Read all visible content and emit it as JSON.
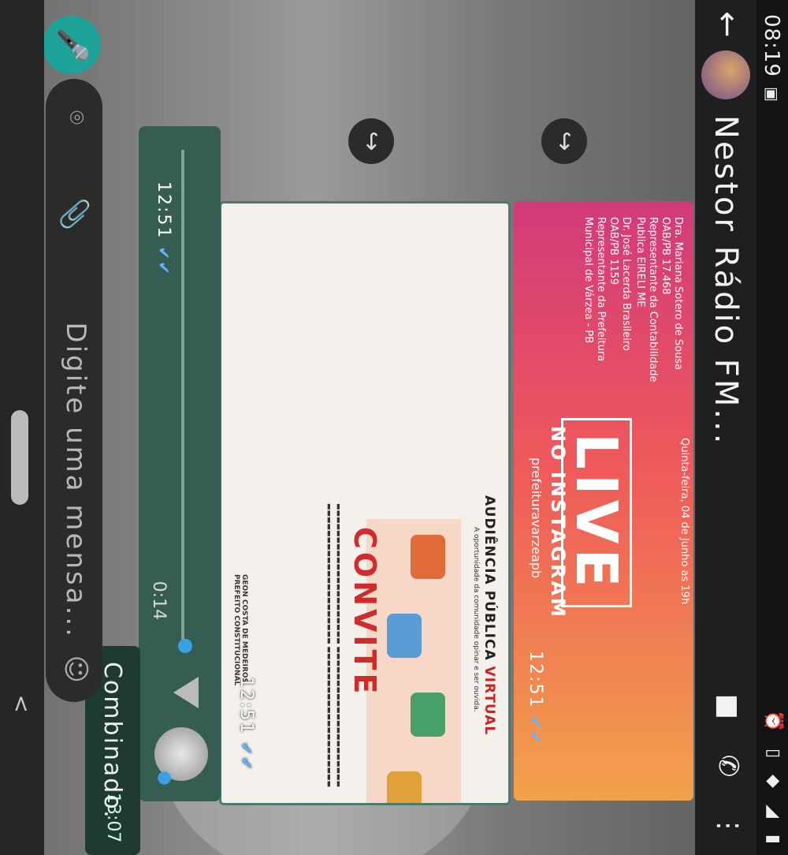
{
  "status_bar": {
    "time": "08:19",
    "icons": [
      "notification-icon",
      "alarm-icon",
      "vibrate-icon",
      "wifi-icon",
      "signal-icon",
      "battery-icon"
    ]
  },
  "app_bar": {
    "title": "Nestor Rádio FM...",
    "actions": [
      "video-call-icon",
      "phone-icon",
      "more-icon"
    ]
  },
  "messages": {
    "poster1": {
      "banner_live": "LIVE",
      "banner_instagram": "NO INSTAGRAM",
      "banner_date": "Quinta-feira, 04 de Junho as 19h",
      "handle": "prefeituravarzeapb",
      "person_left_name": "Dra. Mariana Sotero de Sousa",
      "person_left_oab": "OAB/PB 17.468",
      "person_left_role": "Representante da Contabilidade Publica EIRELI ME",
      "person_right_name": "Dr. José Lacerda Brasileiro",
      "person_right_oab": "OAB/PB 1159",
      "person_right_role": "Representante da Prefeitura Municipal de Várzea - PB",
      "time": "12:51"
    },
    "poster2": {
      "header_part1": "AUDIÊNCIA PÚBLICA",
      "header_part2": "VIRTUAL",
      "subtitle": "A oportunidade da comunidade opinar e ser ouvida.",
      "convite": "CONVITE",
      "signature_line1": "GEON COSTA DE MEDEIROS",
      "signature_line2": "PREFEITO CONSTITUCIONAL",
      "time": "12:51"
    },
    "audio": {
      "duration": "0:14",
      "progress": 0.05,
      "time": "12:51"
    },
    "text": {
      "content": "Combinado.",
      "time": "13:07"
    }
  },
  "composer": {
    "placeholder": "Digite uma mensa..."
  },
  "colors": {
    "accent": "#1ea39a",
    "read_tick": "#5fb4ff",
    "bubble_out": "#365d52"
  }
}
